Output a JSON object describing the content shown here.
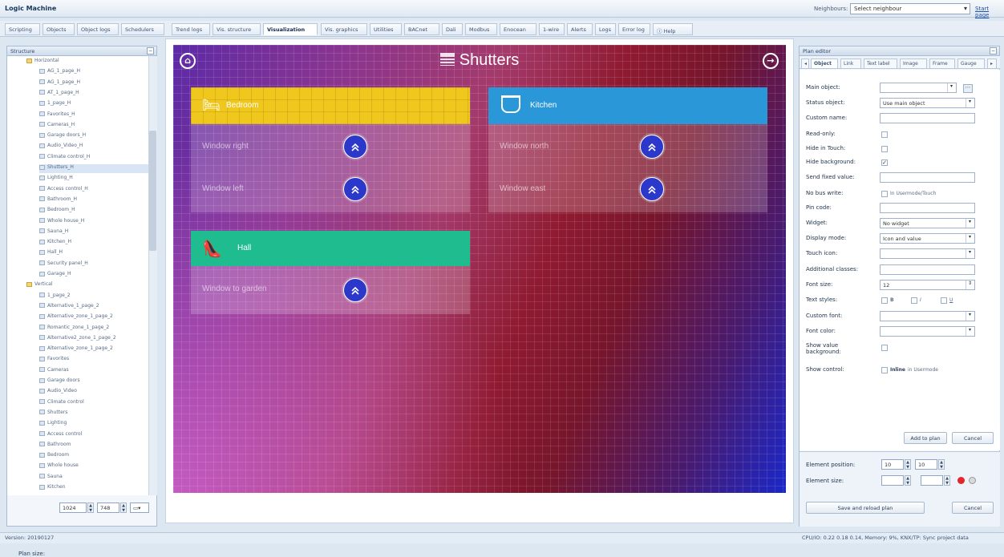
{
  "app": {
    "title": "Logic Machine",
    "neighbours_label": "Neighbours:",
    "neighbours_value": "Select neighbour",
    "start_page": "Start page"
  },
  "tabs": [
    "Scripting",
    "Objects",
    "Object logs",
    "Schedulers",
    "Trend logs",
    "Vis. structure",
    "Visualization",
    "Vis. graphics",
    "Utilities",
    "BACnet",
    "Dali",
    "Modbus",
    "Enocean",
    "1-wire",
    "Alerts",
    "Logs",
    "Error log",
    "Help"
  ],
  "structure": {
    "title": "Structure",
    "items": [
      "Horizontal",
      "AG_1_page_H",
      "AG_1_page_H",
      "AT_1_page_H",
      "1_page_H",
      "Favorites_H",
      "Cameras_H",
      "Garage doors_H",
      "Audio_Video_H",
      "Climate control_H",
      "Shutters_H",
      "Lighting_H",
      "Access control_H",
      "Bathroom_H",
      "Bedroom_H",
      "Whole house_H",
      "Sauna_H",
      "Kitchen_H",
      "Hall_H",
      "Security panel_H",
      "Garage_H",
      "Vertical",
      "1_page_2",
      "Alternative_1_page_2",
      "Alternative_zone_1_page_2",
      "Romantic_zone_1_page_2",
      "Alternative2_zone_1_page_2",
      "Alternative_zone_1_page_2",
      "Favorites",
      "Cameras",
      "Garage doors",
      "Audio_Video",
      "Climate control",
      "Shutters",
      "Lighting",
      "Access control",
      "Bathroom",
      "Bedroom",
      "Whole house",
      "Sauna",
      "Kitchen"
    ],
    "plan_size_label": "Plan size:",
    "plan_width": "1024",
    "plan_height": "748"
  },
  "plan": {
    "title": "Shutters",
    "rooms": [
      {
        "name": "Bedroom",
        "color": "#f0c71c",
        "windows": [
          "Window right",
          "Window left"
        ]
      },
      {
        "name": "Kitchen",
        "color": "#2a97d8",
        "windows": [
          "Window north",
          "Window east"
        ]
      },
      {
        "name": "Hall",
        "color": "#1fbc8f",
        "windows": [
          "Window to garden"
        ]
      }
    ]
  },
  "editor": {
    "title": "Plan editor",
    "tabs": [
      "Object",
      "Link",
      "Text label",
      "Image",
      "Frame",
      "Gauge"
    ],
    "fields": {
      "main_object": "Main object:",
      "status_object": "Status object:",
      "status_object_value": "Use main object",
      "custom_name": "Custom name:",
      "read_only": "Read-only:",
      "hide_in_touch": "Hide in Touch:",
      "hide_background": "Hide background:",
      "send_fixed": "Send fixed value:",
      "no_bus_write": "No bus write:",
      "no_bus_write_note": "In Usermode/Touch",
      "pin_code": "Pin code:",
      "widget": "Widget:",
      "widget_value": "No widget",
      "display_mode": "Display mode:",
      "display_mode_value": "Icon and value",
      "touch_icon": "Touch icon:",
      "additional_classes": "Additional classes:",
      "font_size": "Font size:",
      "font_size_value": "12",
      "text_styles": "Text styles:",
      "style_b": "B",
      "style_i": "I",
      "style_u": "U",
      "custom_font": "Custom font:",
      "font_color": "Font color:",
      "show_value_bg": "Show value background:",
      "show_control": "Show control:",
      "show_control_inline": "Inline",
      "show_control_note": "in Usermode"
    },
    "add_to_plan": "Add to plan",
    "cancel": "Cancel",
    "element_position": "Element position:",
    "pos_x": "10",
    "pos_y": "10",
    "element_size": "Element size:",
    "save_reload": "Save and reload plan",
    "cancel2": "Cancel"
  },
  "status": {
    "version": "Version: 20190127",
    "cpu": "CPU/IO: 0.22 0.18 0.14, Memory: 9%, KNX/TP: Sync project data"
  }
}
